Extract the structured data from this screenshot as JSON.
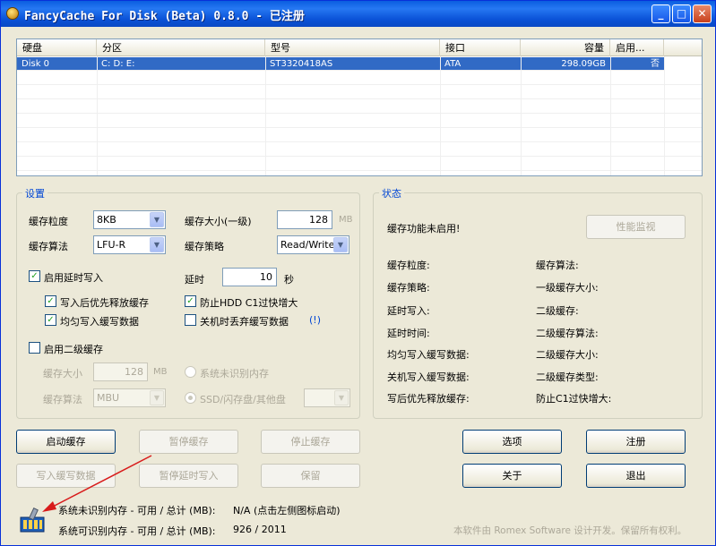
{
  "window": {
    "title": "FancyCache For Disk (Beta) 0.8.0 - 已注册",
    "min_glyph": "_",
    "max_glyph": "□",
    "close_glyph": "✕"
  },
  "disk_list": {
    "columns": [
      "硬盘",
      "分区",
      "型号",
      "接口",
      "容量",
      "启用..."
    ],
    "rows": [
      [
        "Disk 0",
        "C: D: E:",
        "ST3320418AS",
        "ATA",
        "298.09GB",
        "否"
      ]
    ]
  },
  "settings": {
    "title": "设置",
    "granularity_label": "缓存粒度",
    "granularity_value": "8KB",
    "algorithm_label": "缓存算法",
    "algorithm_value": "LFU-R",
    "size_l1_label": "缓存大小(一级)",
    "size_l1_value": "128",
    "size_l1_unit": "MB",
    "strategy_label": "缓存策略",
    "strategy_value": "Read/Write",
    "deferred_write_label": "启用延时写入",
    "delay_label": "延时",
    "delay_value": "10",
    "delay_unit": "秒",
    "release_after_write_label": "写入后优先释放缓存",
    "prevent_hdd_c1_label": "防止HDD C1过快增大",
    "even_write_label": "均匀写入缓写数据",
    "discard_on_shutdown_label": "关机时丢弃缓写数据",
    "info_link": "(!)",
    "l2_enable_label": "启用二级缓存",
    "l2_size_label": "缓存大小",
    "l2_size_value": "128",
    "l2_size_unit": "MB",
    "l2_algorithm_label": "缓存算法",
    "l2_algorithm_value": "MBU",
    "l2_source_unrecognized": "系统未识别内存",
    "l2_source_ssd": "SSD/闪存盘/其他盘"
  },
  "status": {
    "title": "状态",
    "not_enabled": "缓存功能未启用!",
    "monitor_button": "性能监视",
    "left": [
      "缓存粒度:",
      "缓存策略:",
      "延时写入:",
      "延时时间:",
      "均匀写入缓写数据:",
      "关机写入缓写数据:",
      "写后优先释放缓存:"
    ],
    "right": [
      "缓存算法:",
      "一级缓存大小:",
      "二级缓存:",
      "二级缓存算法:",
      "二级缓存大小:",
      "二级缓存类型:",
      "防止C1过快增大:"
    ]
  },
  "buttons": {
    "start": "启动缓存",
    "pause": "暂停缓存",
    "stop": "停止缓存",
    "write_cached": "写入缓写数据",
    "pause_deferred": "暂停延时写入",
    "keep": "保留",
    "options": "选项",
    "register": "注册",
    "about": "关于",
    "exit": "退出"
  },
  "footer": {
    "unrecognized_label": "系统未识别内存 - 可用 / 总计 (MB):",
    "unrecognized_value": "N/A (点击左侧图标启动)",
    "recognized_label": "系统可识别内存 - 可用 / 总计 (MB):",
    "recognized_value": "926 / 2011",
    "copyright": "本软件由 Romex Software 设计开发。保留所有权利。"
  },
  "colors": {
    "title_bar": "#0a5ee0",
    "selection": "#316ac5",
    "group_label": "#0046d5",
    "arrow": "#d81b1b"
  }
}
